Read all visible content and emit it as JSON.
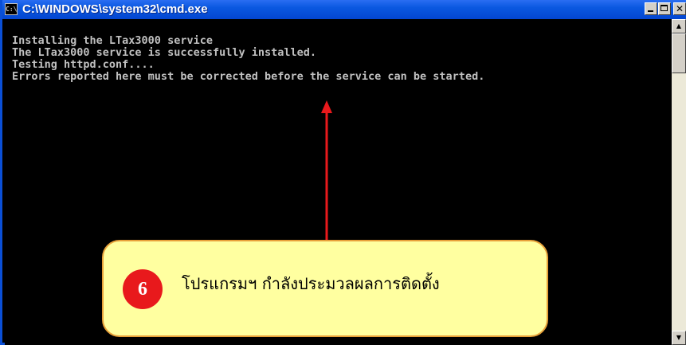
{
  "window": {
    "title": "C:\\WINDOWS\\system32\\cmd.exe",
    "app_icon_text": "C:\\",
    "icon": "cmd-icon",
    "controls": {
      "minimize_icon": "minimize-icon",
      "maximize_icon": "maximize-icon",
      "close_icon": "close-icon",
      "close_glyph": "✕"
    }
  },
  "console": {
    "lines": [
      "Installing the LTax3000 service",
      "The LTax3000 service is successfully installed.",
      "Testing httpd.conf....",
      "Errors reported here must be corrected before the service can be started."
    ],
    "text_color": "#c0c0c0",
    "background": "#000000"
  },
  "scrollbar": {
    "up_glyph": "▲",
    "down_glyph": "▼"
  },
  "callout": {
    "step_number": "6",
    "text": "โปรแกรมฯ  กำลังประมวลผลการติดตั้ง",
    "background": "#ffffa0",
    "badge_color": "#e8191c",
    "arrow_color": "#e8191c"
  },
  "colors": {
    "titlebar": "#0a58e0",
    "window_border": "#0a4fd6",
    "button_face": "#d4d0c8"
  }
}
